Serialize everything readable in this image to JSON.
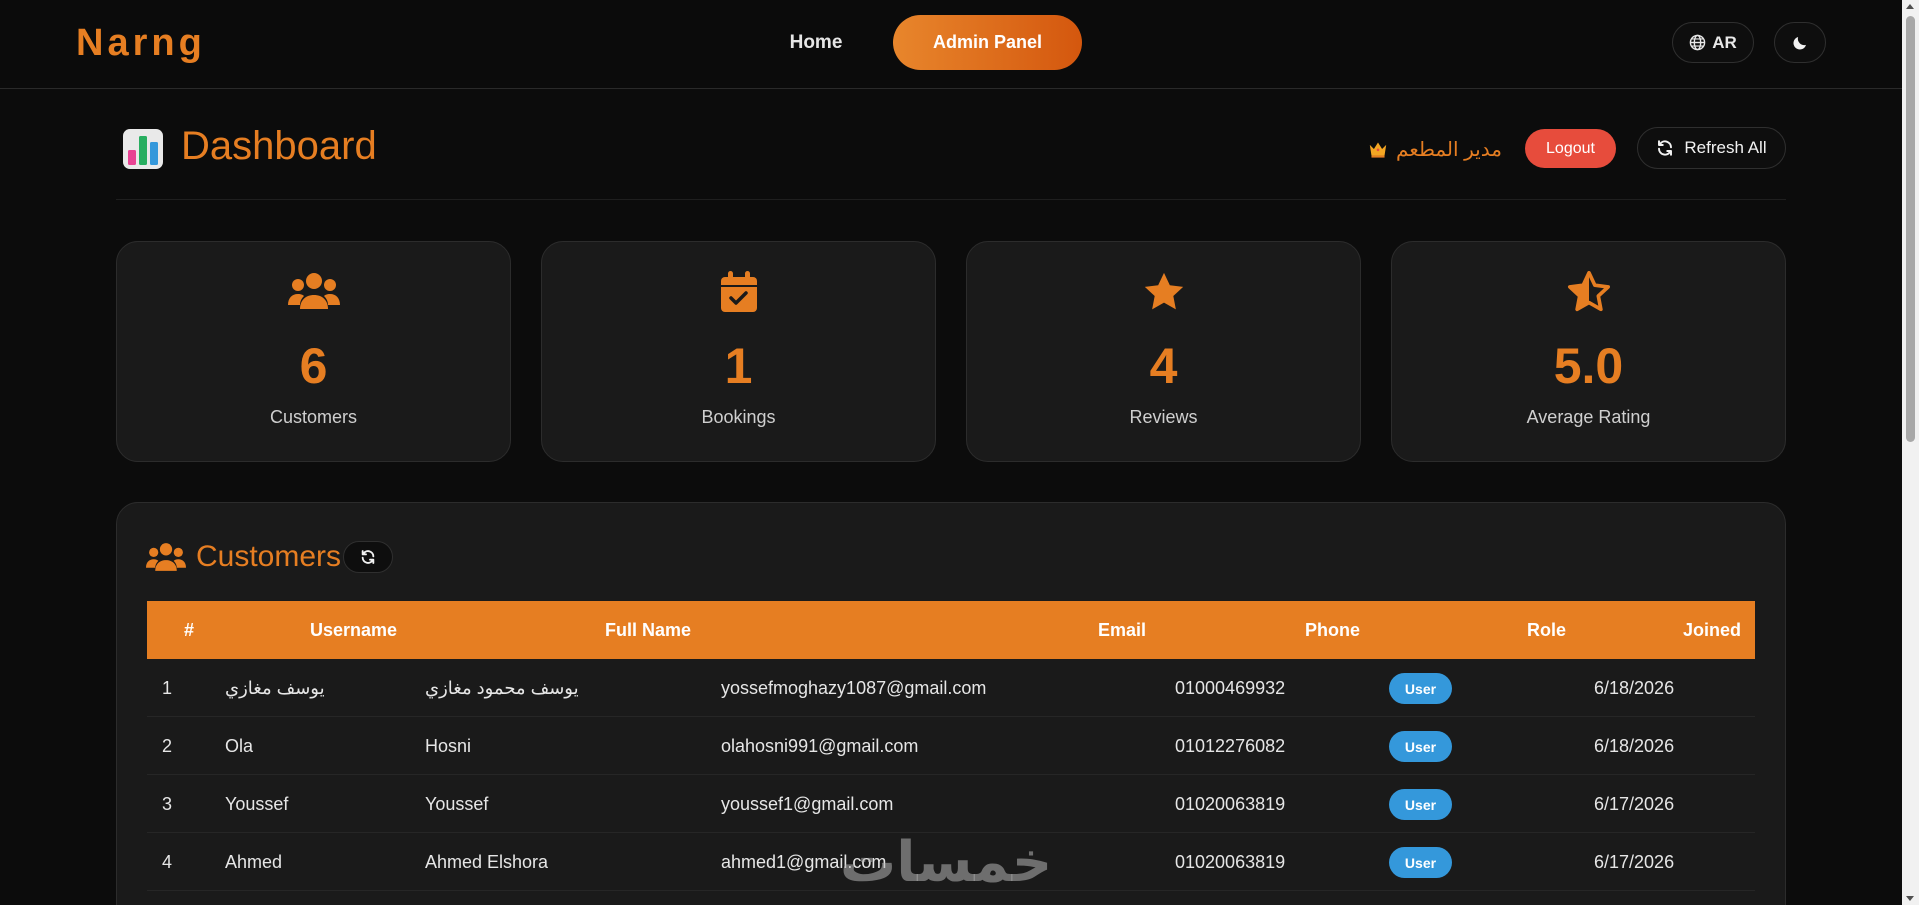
{
  "nav": {
    "brand": "Narng",
    "home": "Home",
    "admin_panel": "Admin Panel",
    "lang": "AR"
  },
  "header": {
    "title": "Dashboard",
    "manager": "مدير المطعم",
    "logout": "Logout",
    "refresh_all": "Refresh All"
  },
  "stats": [
    {
      "value": "6",
      "label": "Customers",
      "icon": "users-icon"
    },
    {
      "value": "1",
      "label": "Bookings",
      "icon": "calendar-check-icon"
    },
    {
      "value": "4",
      "label": "Reviews",
      "icon": "star-icon"
    },
    {
      "value": "5.0",
      "label": "Average Rating",
      "icon": "star-half-icon"
    }
  ],
  "customers": {
    "title": "Customers",
    "columns": [
      "#",
      "Username",
      "Full Name",
      "Email",
      "Phone",
      "Role",
      "Joined"
    ],
    "rows": [
      {
        "num": "1",
        "username": "يوسف مغازي",
        "full_name": "يوسف محمود مغازي",
        "email": "yossefmoghazy1087@gmail.com",
        "phone": "01000469932",
        "role": "User",
        "joined": "6/18/2026"
      },
      {
        "num": "2",
        "username": "Ola",
        "full_name": "Hosni",
        "email": "olahosni991@gmail.com",
        "phone": "01012276082",
        "role": "User",
        "joined": "6/18/2026"
      },
      {
        "num": "3",
        "username": "Youssef",
        "full_name": "Youssef",
        "email": "youssef1@gmail.com",
        "phone": "01020063819",
        "role": "User",
        "joined": "6/17/2026"
      },
      {
        "num": "4",
        "username": "Ahmed",
        "full_name": "Ahmed Elshora",
        "email": "ahmed1@gmail.com",
        "phone": "01020063819",
        "role": "User",
        "joined": "6/17/2026"
      }
    ]
  },
  "watermark": "خمسات",
  "colors": {
    "accent": "#e67e22",
    "logout": "#e74c3c",
    "badge": "#3498db"
  }
}
